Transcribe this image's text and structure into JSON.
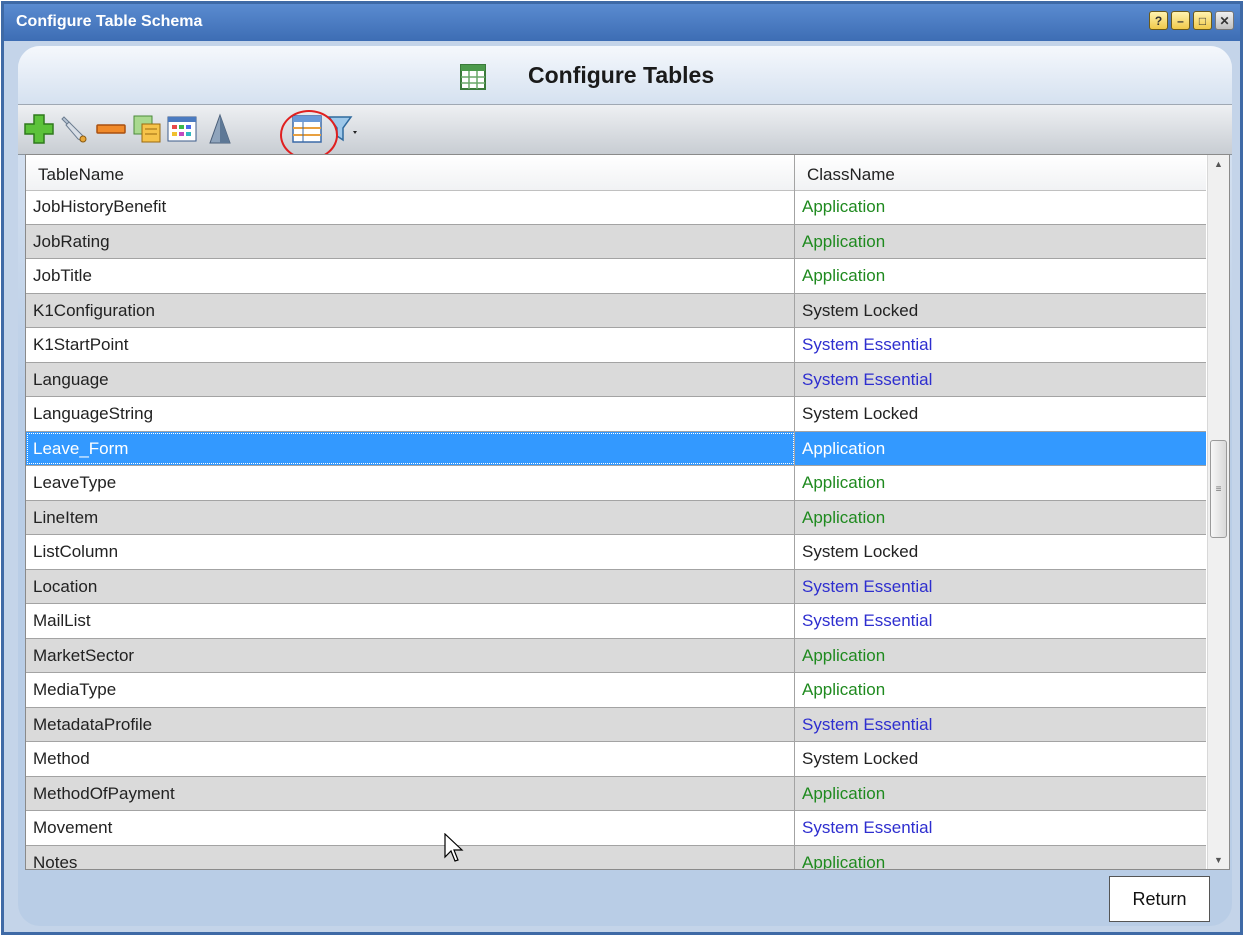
{
  "window": {
    "title": "Configure Table Schema"
  },
  "title_buttons": [
    {
      "name": "help-button",
      "glyph": "?"
    },
    {
      "name": "minimize-button",
      "glyph": "–"
    },
    {
      "name": "maximize-button",
      "glyph": "□"
    },
    {
      "name": "close-button",
      "glyph": "✕"
    }
  ],
  "header": {
    "title": "Configure Tables",
    "icon": "table-icon"
  },
  "toolbar": {
    "tools": [
      {
        "name": "add-icon",
        "action": "add"
      },
      {
        "name": "wrench-icon",
        "action": "edit"
      },
      {
        "name": "remove-icon",
        "action": "delete"
      },
      {
        "name": "copy-icon",
        "action": "copy"
      },
      {
        "name": "color-grid-icon",
        "action": "layout"
      },
      {
        "name": "sort-pyramid-icon",
        "action": "sort"
      },
      {
        "name": "table-columns-icon",
        "action": "columns",
        "highlighted": true
      },
      {
        "name": "filter-dropdown-icon",
        "action": "filter"
      }
    ]
  },
  "grid": {
    "columns": {
      "col1": "TableName",
      "col2": "ClassName"
    },
    "colors": {
      "Application": "#1f8a1f",
      "System Essential": "#2e2ecf",
      "System Locked": "#222222"
    },
    "rows": [
      {
        "name": "JobHistoryBenefit",
        "class": "Application"
      },
      {
        "name": "JobRating",
        "class": "Application"
      },
      {
        "name": "JobTitle",
        "class": "Application"
      },
      {
        "name": "K1Configuration",
        "class": "System Locked"
      },
      {
        "name": "K1StartPoint",
        "class": "System Essential"
      },
      {
        "name": "Language",
        "class": "System Essential"
      },
      {
        "name": "LanguageString",
        "class": "System Locked"
      },
      {
        "name": "Leave_Form",
        "class": "Application",
        "selected": true
      },
      {
        "name": "LeaveType",
        "class": "Application"
      },
      {
        "name": "LineItem",
        "class": "Application"
      },
      {
        "name": "ListColumn",
        "class": "System Locked"
      },
      {
        "name": "Location",
        "class": "System Essential"
      },
      {
        "name": "MailList",
        "class": "System Essential"
      },
      {
        "name": "MarketSector",
        "class": "Application"
      },
      {
        "name": "MediaType",
        "class": "Application"
      },
      {
        "name": "MetadataProfile",
        "class": "System Essential"
      },
      {
        "name": "Method",
        "class": "System Locked"
      },
      {
        "name": "MethodOfPayment",
        "class": "Application"
      },
      {
        "name": "Movement",
        "class": "System Essential"
      },
      {
        "name": "Notes",
        "class": "Application"
      }
    ]
  },
  "footer": {
    "return_label": "Return"
  }
}
